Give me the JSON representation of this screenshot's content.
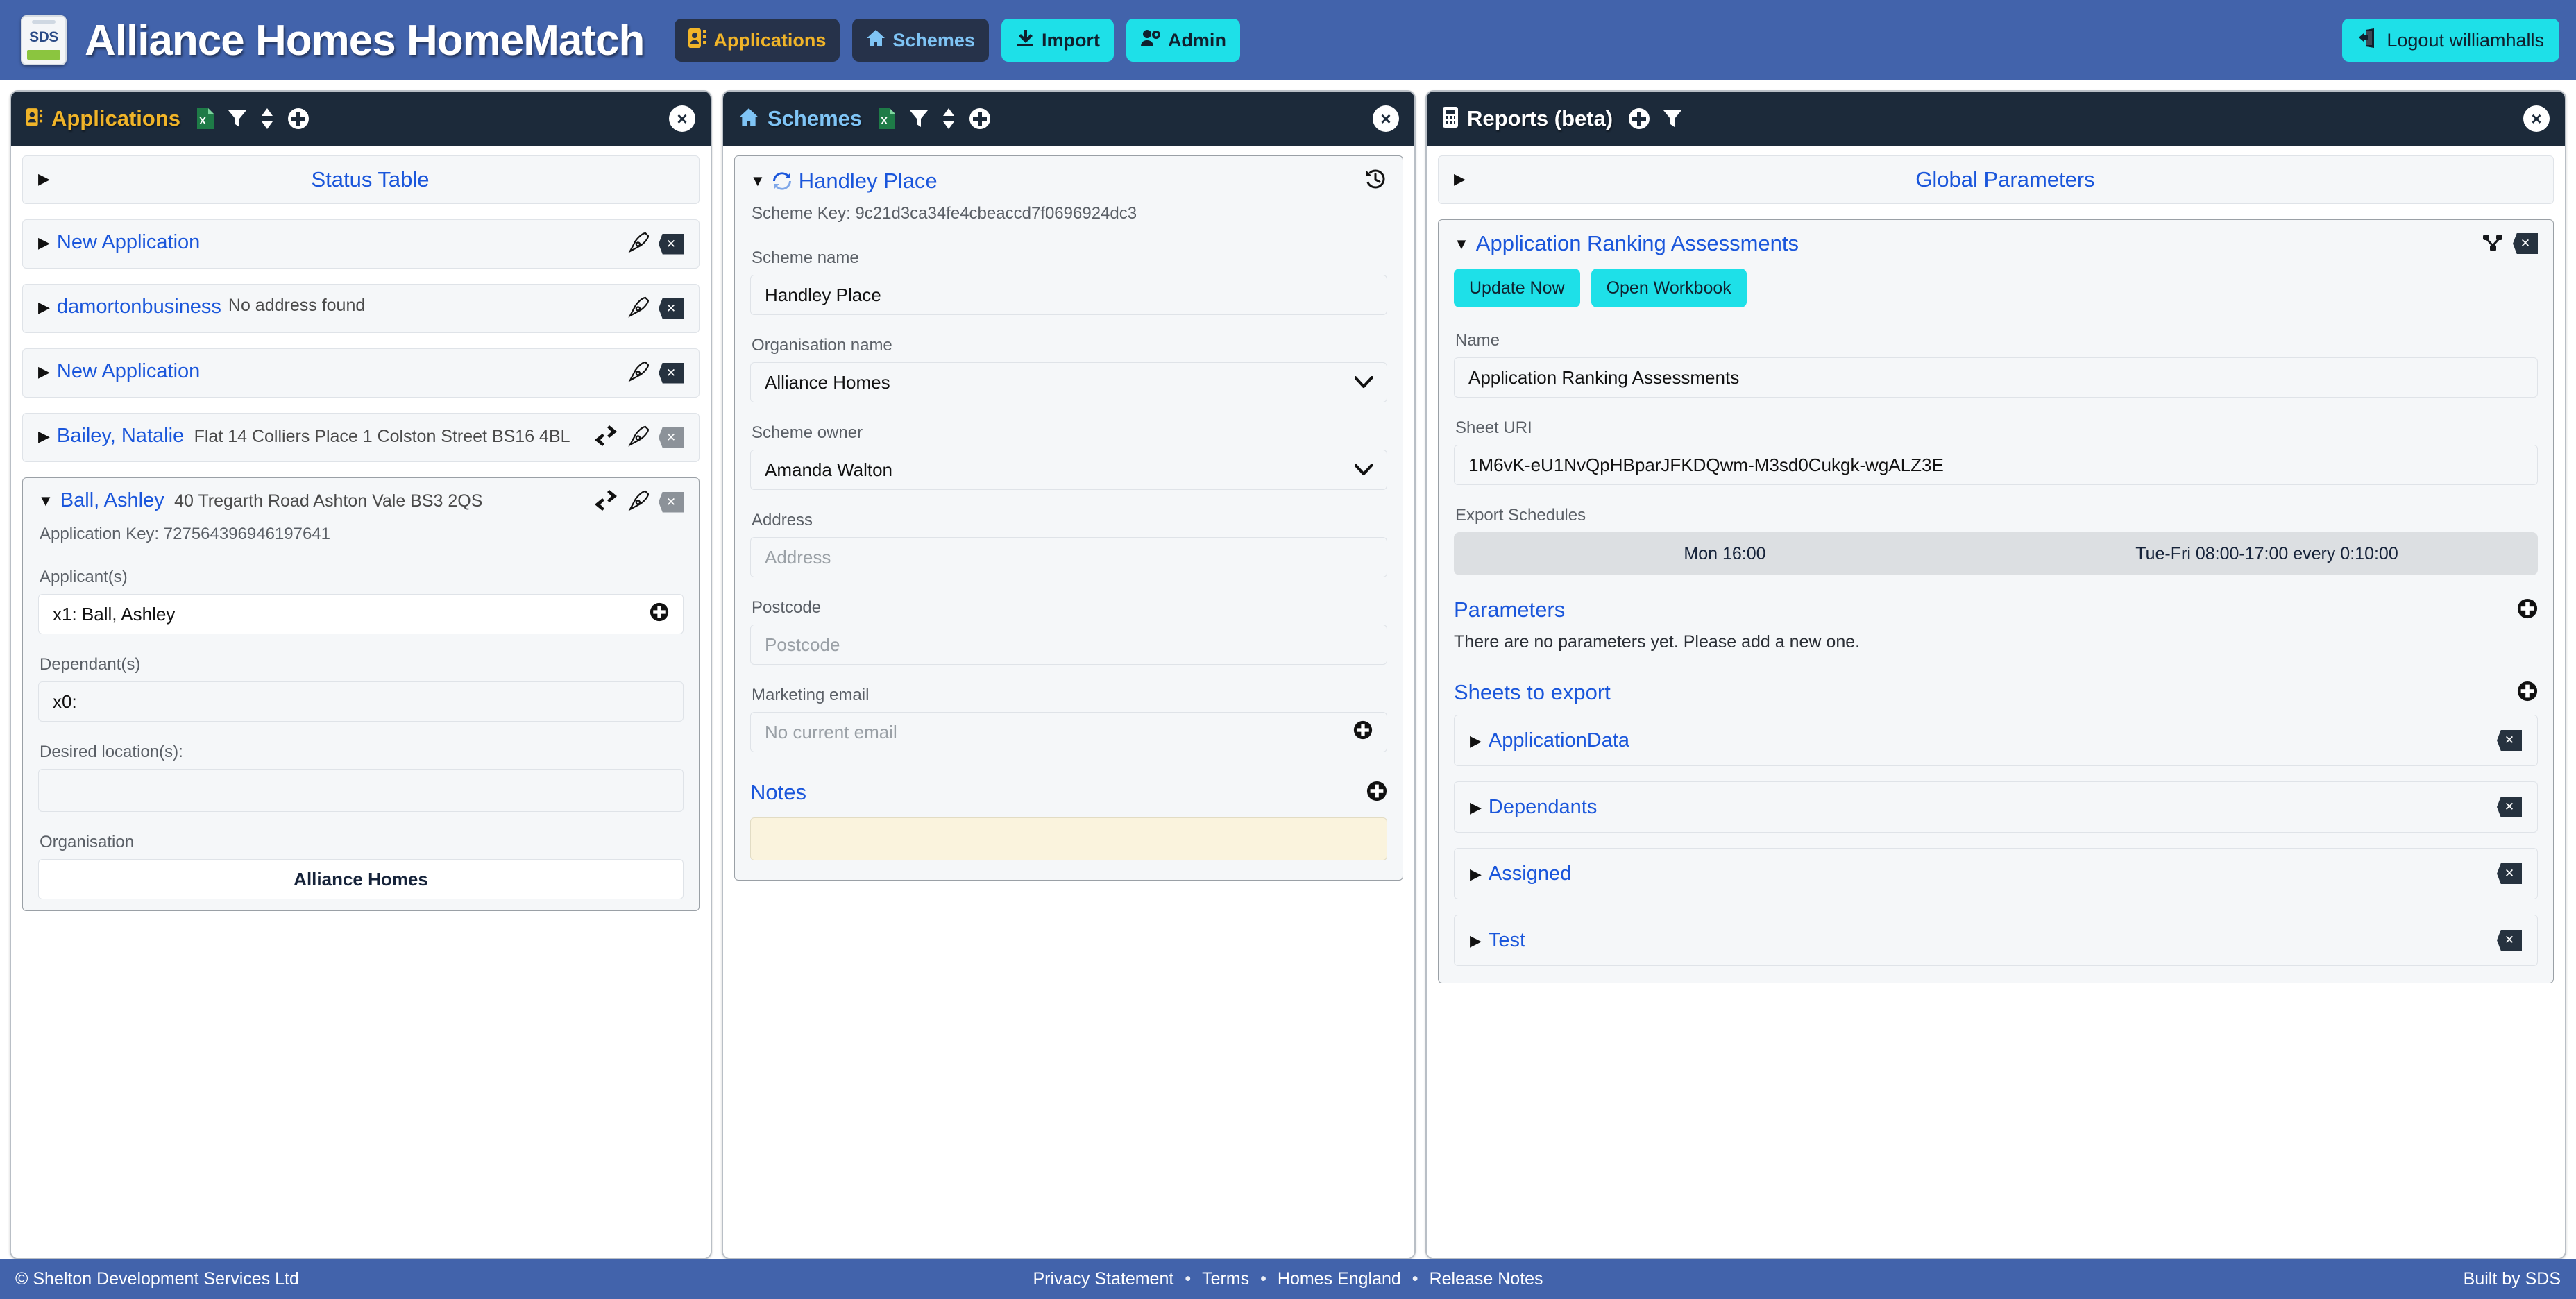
{
  "header": {
    "logo_text": "SDS",
    "title": "Alliance Homes HomeMatch",
    "nav": [
      {
        "label": "Applications",
        "icon": "contact-card-icon",
        "style": "dark-amber"
      },
      {
        "label": "Schemes",
        "icon": "home-icon",
        "style": "dark-blue"
      },
      {
        "label": "Import",
        "icon": "download-icon",
        "style": "cyan"
      },
      {
        "label": "Admin",
        "icon": "user-gear-icon",
        "style": "cyan"
      }
    ],
    "logout_label": "Logout williamhalls"
  },
  "colors": {
    "brand_blue": "#4263ab",
    "panel_header": "#1c2a3a",
    "accent_cyan": "#1ee0e8",
    "link_blue": "#1a56db",
    "amber": "#f0b429",
    "excel_green": "#1e7b47",
    "note_yellow": "#faf3dd"
  },
  "panels": {
    "applications": {
      "title": "Applications",
      "head_icons": [
        "excel-export-icon",
        "filter-icon",
        "sort-icon",
        "add-icon"
      ],
      "close_label": "×",
      "status_table_label": "Status Table",
      "items": [
        {
          "title": "New Application",
          "subtitle": "",
          "expanded": false,
          "has_swap": false,
          "delete_variant": "dark"
        },
        {
          "title": "damortonbusiness",
          "subtitle": "No address found",
          "expanded": false,
          "has_swap": false,
          "delete_variant": "dark"
        },
        {
          "title": "New Application",
          "subtitle": "",
          "expanded": false,
          "has_swap": false,
          "delete_variant": "dark"
        },
        {
          "title": "Bailey, Natalie",
          "subtitle": "Flat 14 Colliers Place 1 Colston Street BS16 4BL",
          "expanded": false,
          "has_swap": true,
          "delete_variant": "grey"
        }
      ],
      "selected": {
        "title": "Ball, Ashley",
        "subtitle": "40 Tregarth Road Ashton Vale BS3 2QS",
        "application_key_label": "Application Key: 727564396946197641",
        "applicants_label": "Applicant(s)",
        "applicants_value": "x1: Ball, Ashley",
        "dependants_label": "Dependant(s)",
        "dependants_value": "x0:",
        "desired_locations_label": "Desired location(s):",
        "desired_locations_value": "",
        "organisation_label": "Organisation",
        "organisation_value": "Alliance Homes"
      }
    },
    "schemes": {
      "title": "Schemes",
      "head_icons": [
        "excel-export-icon",
        "filter-icon",
        "sort-icon",
        "add-icon"
      ],
      "close_label": "×",
      "scheme_title": "Handley Place",
      "scheme_key_label": "Scheme Key: 9c21d3ca34fe4cbeaccd7f0696924dc3",
      "history_icon": "history-icon",
      "fields": [
        {
          "label": "Scheme name",
          "value": "Handley Place",
          "placeholder": "",
          "type": "text"
        },
        {
          "label": "Organisation name",
          "value": "Alliance Homes",
          "placeholder": "",
          "type": "select"
        },
        {
          "label": "Scheme owner",
          "value": "Amanda Walton",
          "placeholder": "",
          "type": "select"
        },
        {
          "label": "Address",
          "value": "",
          "placeholder": "Address",
          "type": "text"
        },
        {
          "label": "Postcode",
          "value": "",
          "placeholder": "Postcode",
          "type": "text"
        },
        {
          "label": "Marketing email",
          "value": "",
          "placeholder": "No current email",
          "type": "text-add"
        }
      ],
      "notes_label": "Notes",
      "notes_value": ""
    },
    "reports": {
      "title": "Reports (beta)",
      "head_icons": [
        "add-icon",
        "filter-icon"
      ],
      "close_label": "×",
      "global_parameters_label": "Global Parameters",
      "report_title": "Application Ranking Assessments",
      "report_actions": [
        "share-icon",
        "delete-icon"
      ],
      "buttons": [
        {
          "label": "Update Now"
        },
        {
          "label": "Open Workbook"
        }
      ],
      "name_label": "Name",
      "name_value": "Application Ranking Assessments",
      "sheet_uri_label": "Sheet URI",
      "sheet_uri_value": "1M6vK-eU1NvQpHBparJFKDQwm-M3sd0Cukgk-wgALZ3E",
      "export_schedules_label": "Export Schedules",
      "export_schedules": [
        "Mon 16:00",
        "Tue-Fri 08:00-17:00 every 0:10:00"
      ],
      "parameters_label": "Parameters",
      "parameters_empty": "There are no parameters yet. Please add a new one.",
      "sheets_label": "Sheets to export",
      "sheets": [
        {
          "label": "ApplicationData"
        },
        {
          "label": "Dependants"
        },
        {
          "label": "Assigned"
        },
        {
          "label": "Test"
        }
      ]
    }
  },
  "footer": {
    "copyright": "© Shelton Development Services Ltd",
    "links": [
      "Privacy Statement",
      "Terms",
      "Homes England",
      "Release Notes"
    ],
    "built_by": "Built by SDS"
  }
}
